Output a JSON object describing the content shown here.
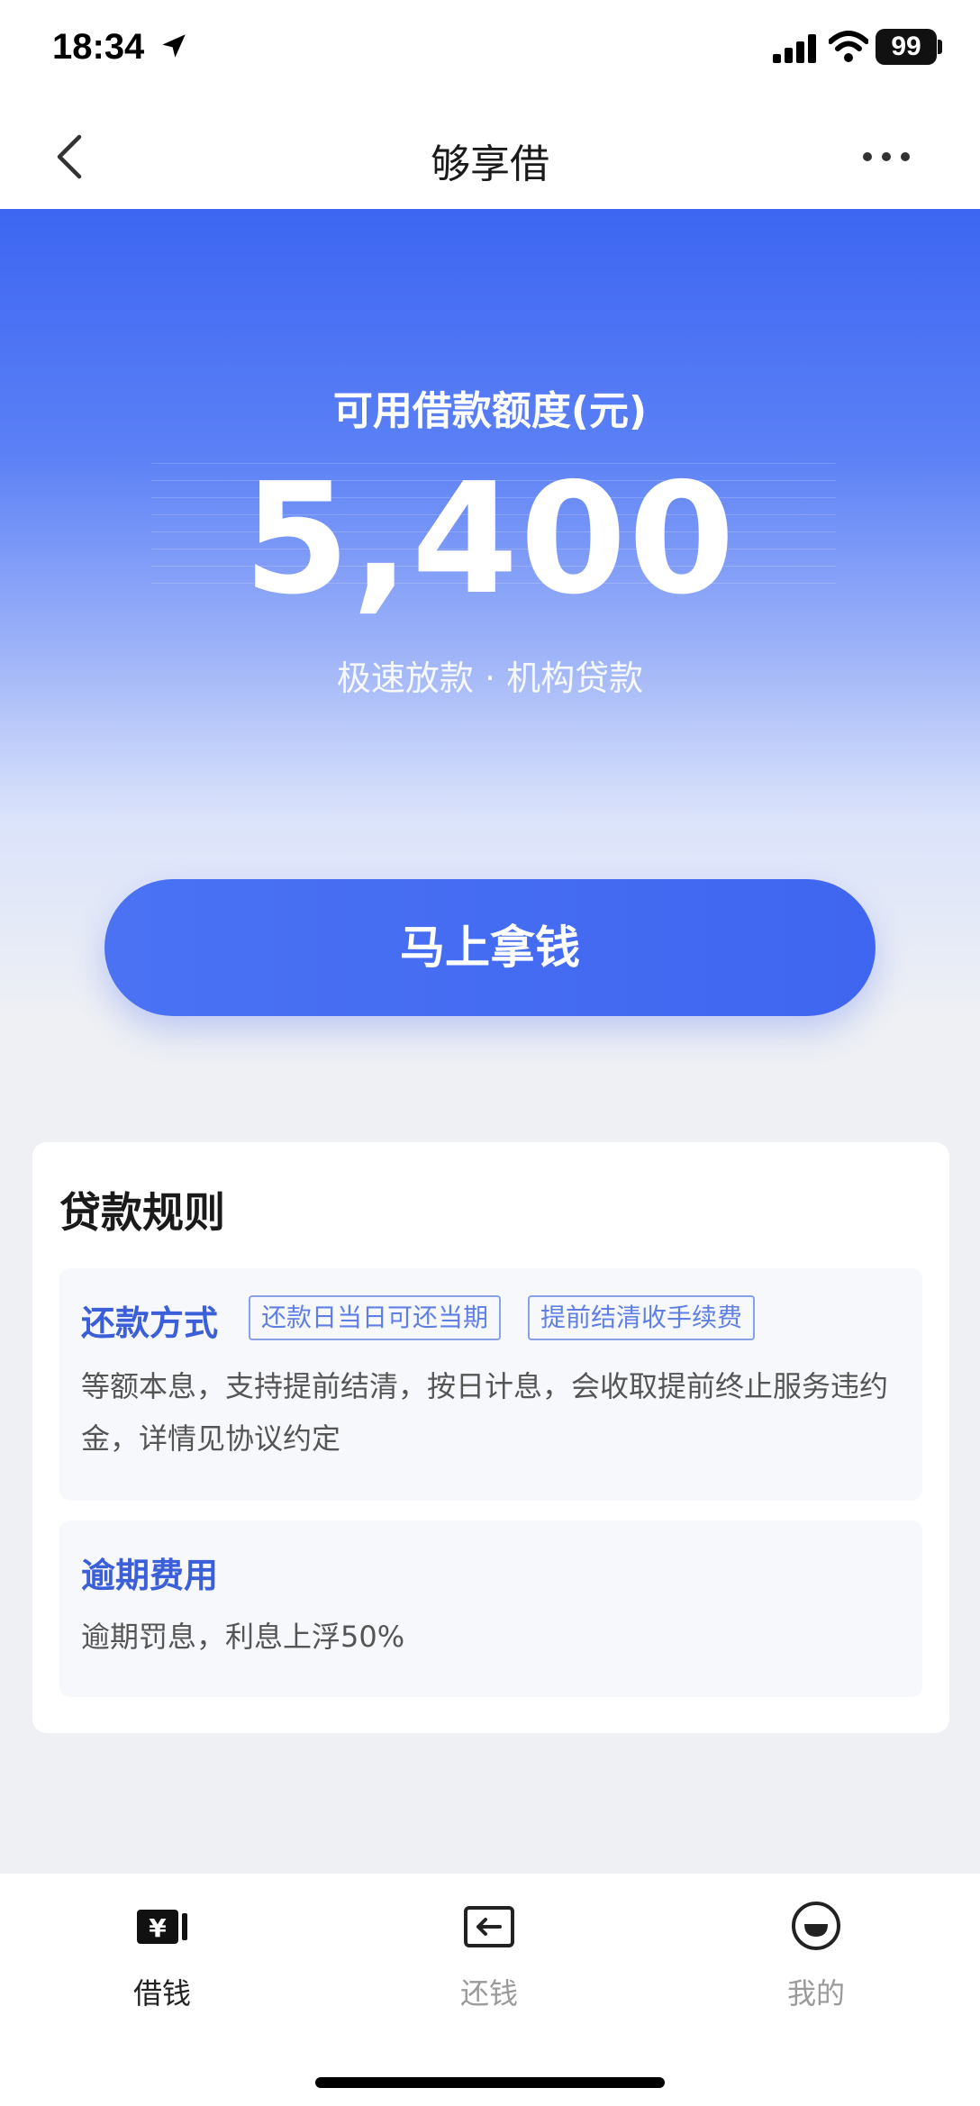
{
  "status_bar": {
    "time": "18:34",
    "battery": "99",
    "icons": [
      "location-arrow-icon",
      "signal-icon",
      "wifi-icon",
      "battery-icon"
    ]
  },
  "nav": {
    "title": "够享借",
    "icons": [
      "back-chevron-icon",
      "more-dots-icon"
    ]
  },
  "hero": {
    "label": "可用借款额度(元)",
    "amount": "5,400",
    "subtitle": "极速放款 · 机构贷款",
    "cta_label": "马上拿钱"
  },
  "rules": {
    "title": "贷款规则",
    "repayment": {
      "heading": "还款方式",
      "tags": [
        "还款日当日可还当期",
        "提前结清收手续费"
      ],
      "description": "等额本息，支持提前结清，按日计息，会收取提前终止服务违约金，详情见协议约定"
    },
    "overdue": {
      "heading": "逾期费用",
      "description": "逾期罚息，利息上浮50%"
    }
  },
  "tab_bar": {
    "items": [
      {
        "label": "借钱",
        "icon": "yuan-wallet-icon",
        "active": true
      },
      {
        "label": "还钱",
        "icon": "repay-arrow-icon",
        "active": false
      },
      {
        "label": "我的",
        "icon": "smile-face-icon",
        "active": false
      }
    ]
  },
  "colors": {
    "brand_blue": "#3d66f2",
    "rule_heading": "#3a5fd9",
    "tag_border": "#8aa0e6"
  }
}
